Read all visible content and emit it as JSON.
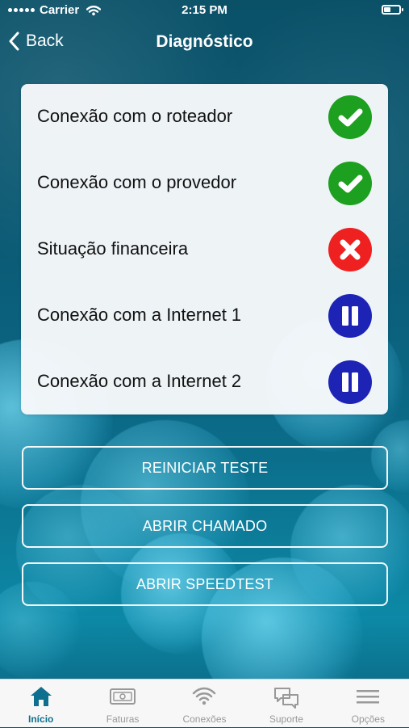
{
  "status_bar": {
    "carrier": "Carrier",
    "time": "2:15 PM"
  },
  "nav": {
    "back_label": "Back",
    "title": "Diagnóstico"
  },
  "diagnostics": [
    {
      "label": "Conexão com o roteador",
      "status": "ok",
      "icon": "check-icon"
    },
    {
      "label": "Conexão com o provedor",
      "status": "ok",
      "icon": "check-icon"
    },
    {
      "label": "Situação financeira",
      "status": "error",
      "icon": "x-icon"
    },
    {
      "label": "Conexão com a Internet 1",
      "status": "paused",
      "icon": "pause-icon"
    },
    {
      "label": "Conexão com a Internet 2",
      "status": "paused",
      "icon": "pause-icon"
    }
  ],
  "actions": {
    "restart": "REINICIAR TESTE",
    "open_ticket": "ABRIR CHAMADO",
    "open_speedtest": "ABRIR SPEEDTEST"
  },
  "tabs": [
    {
      "label": "Início",
      "icon": "home-icon",
      "active": true
    },
    {
      "label": "Faturas",
      "icon": "bill-icon",
      "active": false
    },
    {
      "label": "Conexões",
      "icon": "wifi-icon",
      "active": false
    },
    {
      "label": "Suporte",
      "icon": "chat-icon",
      "active": false
    },
    {
      "label": "Opções",
      "icon": "menu-icon",
      "active": false
    }
  ],
  "colors": {
    "ok": "#1d9f1f",
    "error": "#ef2020",
    "paused": "#1d24b5",
    "tab_active": "#0f6f8f",
    "tab_inactive": "#999999"
  }
}
